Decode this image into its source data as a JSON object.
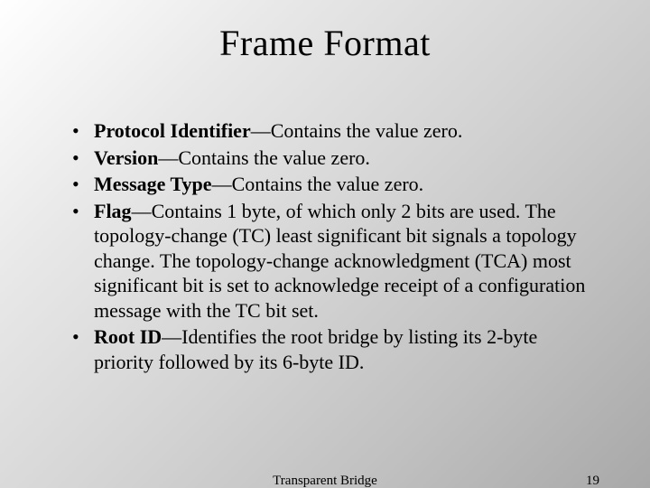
{
  "title": "Frame Format",
  "bullets": [
    {
      "term": "Protocol Identifier",
      "rest": "—Contains the value zero."
    },
    {
      "term": "Version",
      "rest": "—Contains the value zero."
    },
    {
      "term": "Message Type",
      "rest": "—Contains the value zero."
    },
    {
      "term": "Flag",
      "rest": "—Contains 1 byte, of which only 2 bits are used. The topology-change (TC) least significant bit signals a topology change. The topology-change acknowledgment (TCA) most significant bit is set to acknowledge receipt of a configuration message with the TC bit set."
    },
    {
      "term": "Root ID",
      "rest": "—Identifies the root bridge by listing its 2-byte priority followed by its 6-byte ID."
    }
  ],
  "footer": {
    "center": "Transparent Bridge",
    "page": "19"
  }
}
